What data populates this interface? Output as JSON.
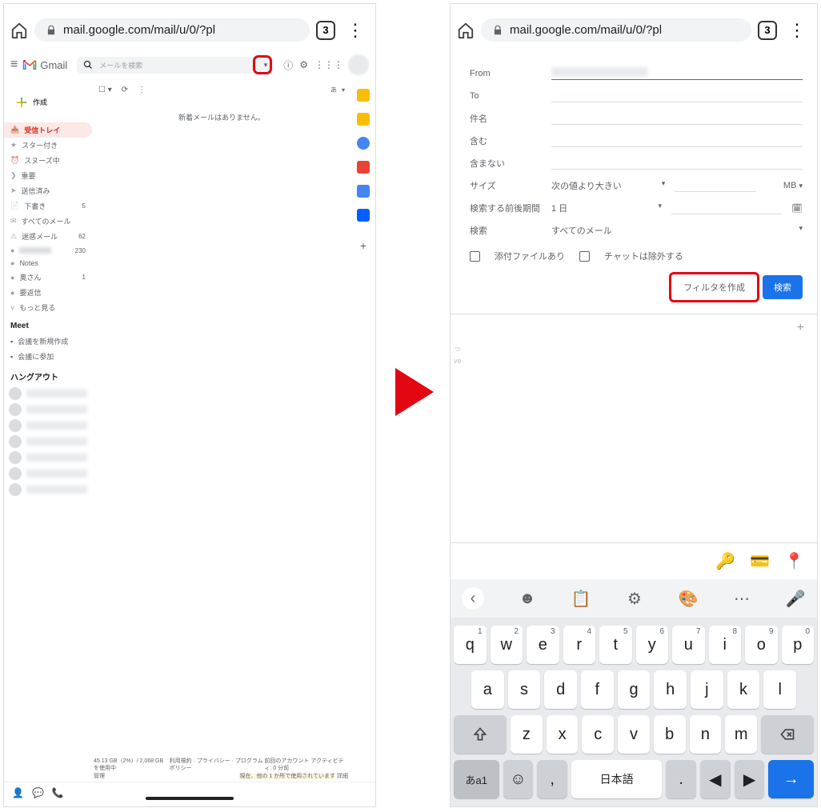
{
  "browser": {
    "url": "mail.google.com/mail/u/0/?pl",
    "tab_count": "3"
  },
  "gmail": {
    "product": "Gmail",
    "search_placeholder": "メールを検索",
    "compose": "作成",
    "toolbar_lang": "あ",
    "empty_message": "新着メールはありません。",
    "sidebar": [
      {
        "icon": "inbox",
        "label": "受信トレイ",
        "count": "",
        "active": true
      },
      {
        "icon": "star",
        "label": "スター付き"
      },
      {
        "icon": "clock",
        "label": "スヌーズ中"
      },
      {
        "icon": "important",
        "label": "重要"
      },
      {
        "icon": "send",
        "label": "送信済み"
      },
      {
        "icon": "draft",
        "label": "下書き",
        "count": "5"
      },
      {
        "icon": "mail",
        "label": "すべてのメール"
      },
      {
        "icon": "spam",
        "label": "迷惑メール",
        "count": "62"
      },
      {
        "icon": "label",
        "label": "",
        "count": "230",
        "blur": true
      },
      {
        "icon": "label",
        "label": "Notes"
      },
      {
        "icon": "label",
        "label": "奥さん",
        "count": "1"
      },
      {
        "icon": "label",
        "label": "要返信"
      },
      {
        "icon": "more",
        "label": "もっと見る"
      }
    ],
    "meet_header": "Meet",
    "meet": [
      {
        "label": "会議を新規作成"
      },
      {
        "label": "会議に参加"
      }
    ],
    "hangout_header": "ハングアウト",
    "footer": {
      "storage": "45.13 GB（2%）/ 2,068 GB を使用中",
      "links": "利用規約 · プライバシー · プログラム ポリシー",
      "activity_top": "前回のアカウント アクティビティ: 0 分前",
      "activity_hl": "現在、他の 1 か所で使用されています",
      "manage": "管理",
      "details": "詳細"
    }
  },
  "filter": {
    "from_label": "From",
    "to_label": "To",
    "subject_label": "件名",
    "has_label": "含む",
    "nothas_label": "含まない",
    "size_label": "サイズ",
    "size_op": "次の値より大きい",
    "size_unit": "MB",
    "date_label": "検索する前後期間",
    "date_value": "1 日",
    "search_label": "検索",
    "search_scope": "すべてのメール",
    "chk_attachment": "添付ファイルあり",
    "chk_chat": "チャットは除外する",
    "create_filter": "フィルタを作成",
    "search_button": "検索"
  },
  "keyboard": {
    "row1": [
      {
        "k": "q",
        "s": "1"
      },
      {
        "k": "w",
        "s": "2"
      },
      {
        "k": "e",
        "s": "3"
      },
      {
        "k": "r",
        "s": "4"
      },
      {
        "k": "t",
        "s": "5"
      },
      {
        "k": "y",
        "s": "6"
      },
      {
        "k": "u",
        "s": "7"
      },
      {
        "k": "i",
        "s": "8"
      },
      {
        "k": "o",
        "s": "9"
      },
      {
        "k": "p",
        "s": "0"
      }
    ],
    "row2": [
      {
        "k": "a"
      },
      {
        "k": "s"
      },
      {
        "k": "d"
      },
      {
        "k": "f"
      },
      {
        "k": "g"
      },
      {
        "k": "h"
      },
      {
        "k": "j"
      },
      {
        "k": "k"
      },
      {
        "k": "l"
      }
    ],
    "row3": [
      {
        "k": "z"
      },
      {
        "k": "x"
      },
      {
        "k": "c"
      },
      {
        "k": "v"
      },
      {
        "k": "b"
      },
      {
        "k": "n"
      },
      {
        "k": "m"
      }
    ],
    "ime": "あa1",
    "space": "日本語",
    "comma": ",",
    "period": "."
  }
}
